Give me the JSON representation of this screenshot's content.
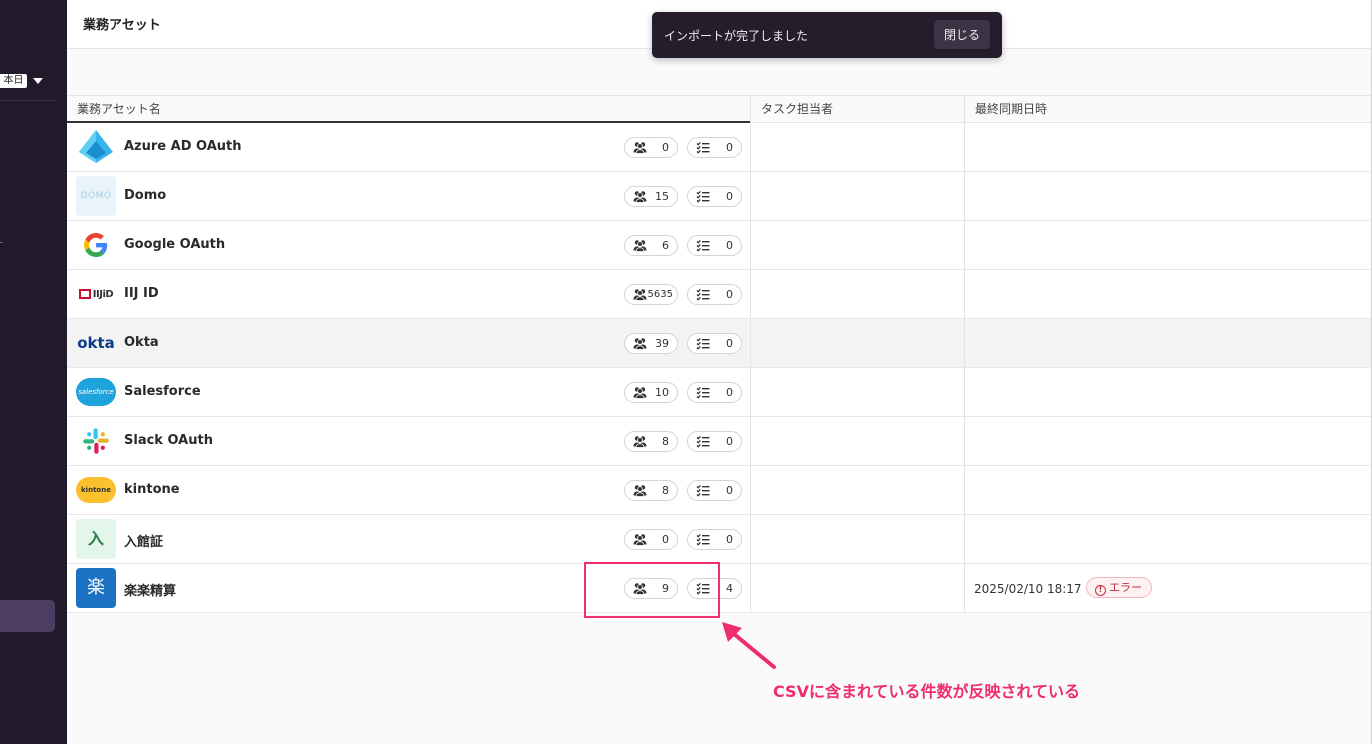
{
  "sidebar": {
    "date_filter": "本日",
    "date_caret_icon": "caret-down-icon"
  },
  "page": {
    "title": "業務アセット"
  },
  "toast": {
    "message": "インポートが完了しました",
    "close_label": "閉じる"
  },
  "table": {
    "columns": [
      "業務アセット名",
      "タスク担当者",
      "最終同期日時"
    ],
    "rows": [
      {
        "name": "Azure AD OAuth",
        "logo": "azure-ad-logo",
        "users": "0",
        "tasks": "0",
        "sync_date": "",
        "status": ""
      },
      {
        "name": "Domo",
        "logo": "domo-logo",
        "logo_text": "DOMO",
        "users": "15",
        "tasks": "0",
        "sync_date": "",
        "status": ""
      },
      {
        "name": "Google OAuth",
        "logo": "google-logo",
        "users": "6",
        "tasks": "0",
        "sync_date": "",
        "status": ""
      },
      {
        "name": "IIJ ID",
        "logo": "iij-logo",
        "logo_text": "IIJiD",
        "users": "5635",
        "tasks": "0",
        "sync_date": "",
        "status": ""
      },
      {
        "name": "Okta",
        "logo": "okta-logo",
        "logo_text": "okta",
        "users": "39",
        "tasks": "0",
        "sync_date": "",
        "status": ""
      },
      {
        "name": "Salesforce",
        "logo": "salesforce-logo",
        "logo_text": "salesforce",
        "users": "10",
        "tasks": "0",
        "sync_date": "",
        "status": ""
      },
      {
        "name": "Slack OAuth",
        "logo": "slack-logo",
        "users": "8",
        "tasks": "0",
        "sync_date": "",
        "status": ""
      },
      {
        "name": "kintone",
        "logo": "kintone-logo",
        "logo_text": "kintone",
        "users": "8",
        "tasks": "0",
        "sync_date": "",
        "status": ""
      },
      {
        "name": "入館証",
        "logo": "entry-pass-logo",
        "logo_text": "入",
        "users": "0",
        "tasks": "0",
        "sync_date": "",
        "status": ""
      },
      {
        "name": "楽楽精算",
        "logo": "rakuraku-logo",
        "logo_text": "楽",
        "users": "9",
        "tasks": "4",
        "sync_date": "2025/02/10 18:17",
        "status": "エラー"
      }
    ],
    "hover_row_index": 4
  },
  "annotation": {
    "text": "CSVに含まれている件数が反映されている",
    "color": "#ee2d6c"
  },
  "colors": {
    "sidebar_bg": "#221a2b",
    "toast_bg": "#251d2c",
    "error": "#c0303f"
  }
}
